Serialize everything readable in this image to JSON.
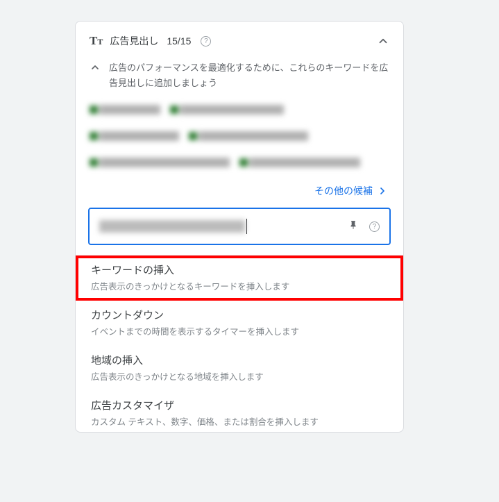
{
  "header": {
    "title": "広告見出し",
    "count": "15/15"
  },
  "subsection": {
    "description": "広告のパフォーマンスを最適化するために、これらのキーワードを広告見出しに追加しましょう"
  },
  "more_candidates": {
    "label": "その他の候補"
  },
  "dropdown": {
    "items": [
      {
        "title": "キーワードの挿入",
        "desc": "広告表示のきっかけとなるキーワードを挿入します"
      },
      {
        "title": "カウントダウン",
        "desc": "イベントまでの時間を表示するタイマーを挿入します"
      },
      {
        "title": "地域の挿入",
        "desc": "広告表示のきっかけとなる地域を挿入します"
      },
      {
        "title": "広告カスタマイザ",
        "desc": "カスタム テキスト、数字、価格、または割合を挿入します"
      }
    ]
  }
}
